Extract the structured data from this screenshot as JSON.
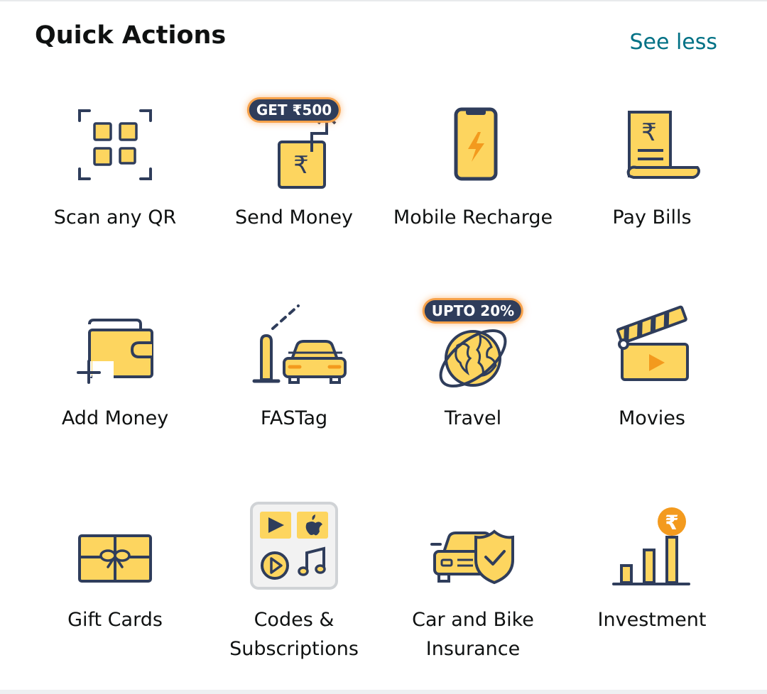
{
  "header": {
    "title": "Quick Actions",
    "toggle_label": "See less"
  },
  "colors": {
    "accent": "#007185",
    "icon_fill": "#fdd55f",
    "icon_stroke": "#2f3d5b",
    "badge_bg": "#2f3d5b",
    "badge_glow": "#f7a24a",
    "orange": "#f39a1e"
  },
  "actions": [
    {
      "label": "Scan any QR",
      "icon": "qr-scan-icon"
    },
    {
      "label": "Send Money",
      "icon": "send-money-icon",
      "badge": "GET ₹500"
    },
    {
      "label": "Mobile Recharge",
      "icon": "mobile-recharge-icon"
    },
    {
      "label": "Pay Bills",
      "icon": "bill-icon"
    },
    {
      "label": "Add Money",
      "icon": "wallet-add-icon"
    },
    {
      "label": "FASTag",
      "icon": "fastag-car-icon"
    },
    {
      "label": "Travel",
      "icon": "globe-icon",
      "badge": "UPTO 20%"
    },
    {
      "label": "Movies",
      "icon": "clapperboard-icon"
    },
    {
      "label": "Gift Cards",
      "icon": "gift-card-icon"
    },
    {
      "label": "Codes & Subscriptions",
      "icon": "app-store-codes-icon"
    },
    {
      "label": "Car and Bike Insurance",
      "icon": "car-insurance-shield-icon"
    },
    {
      "label": "Investment",
      "icon": "investment-chart-icon"
    }
  ]
}
